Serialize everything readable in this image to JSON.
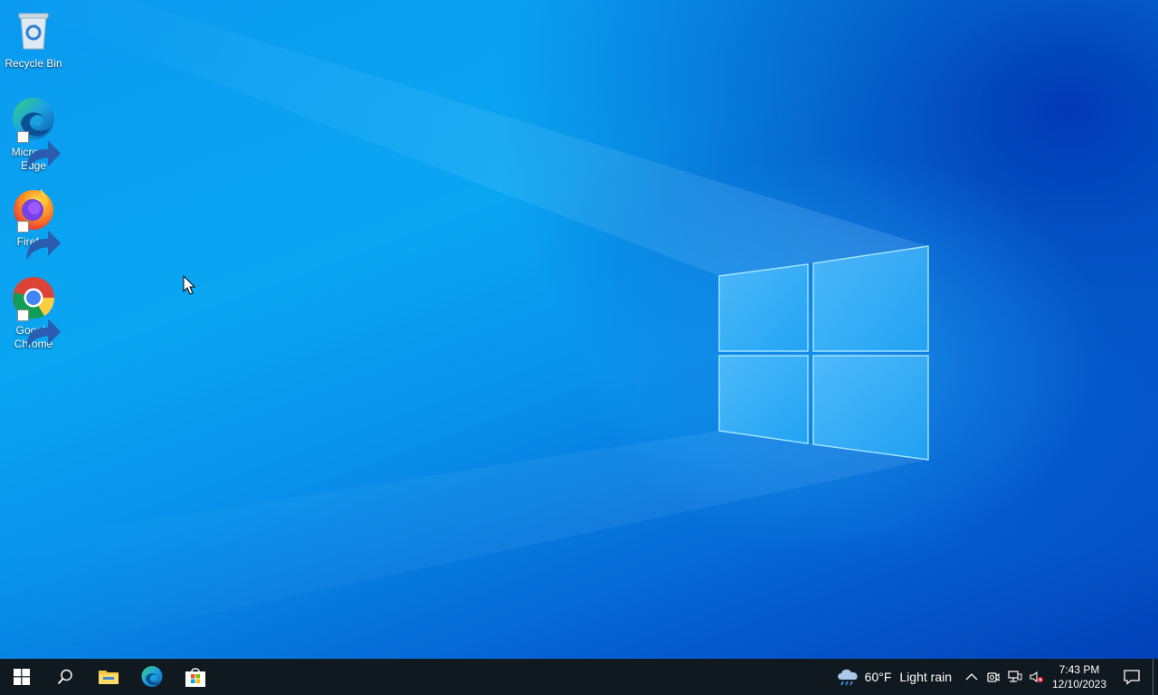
{
  "desktop": {
    "icons": [
      {
        "label": "Recycle Bin",
        "icon": "recycle-bin-icon"
      },
      {
        "label": "Microsoft Edge",
        "icon": "edge-icon"
      },
      {
        "label": "Firefox",
        "icon": "firefox-icon"
      },
      {
        "label": "Google Chrome",
        "icon": "chrome-icon"
      }
    ]
  },
  "taskbar": {
    "start": {
      "icon": "windows-start-icon"
    },
    "search": {
      "icon": "search-icon"
    },
    "pinned": [
      {
        "name": "File Explorer",
        "icon": "file-explorer-icon"
      },
      {
        "name": "Microsoft Edge",
        "icon": "edge-icon"
      },
      {
        "name": "Microsoft Store",
        "icon": "store-icon"
      }
    ],
    "tray": {
      "weather": {
        "temperature": "60°F",
        "condition": "Light rain",
        "icon": "cloud-rain-icon"
      },
      "icons": [
        "chevron-up-icon",
        "meet-now-icon",
        "network-icon",
        "volume-muted-icon"
      ],
      "time": "7:43 PM",
      "date": "12/10/2023",
      "notification_icon": "notification-icon"
    }
  },
  "colors": {
    "taskbar_bg": "#101820",
    "desktop_accent": "#0aa6f2"
  }
}
